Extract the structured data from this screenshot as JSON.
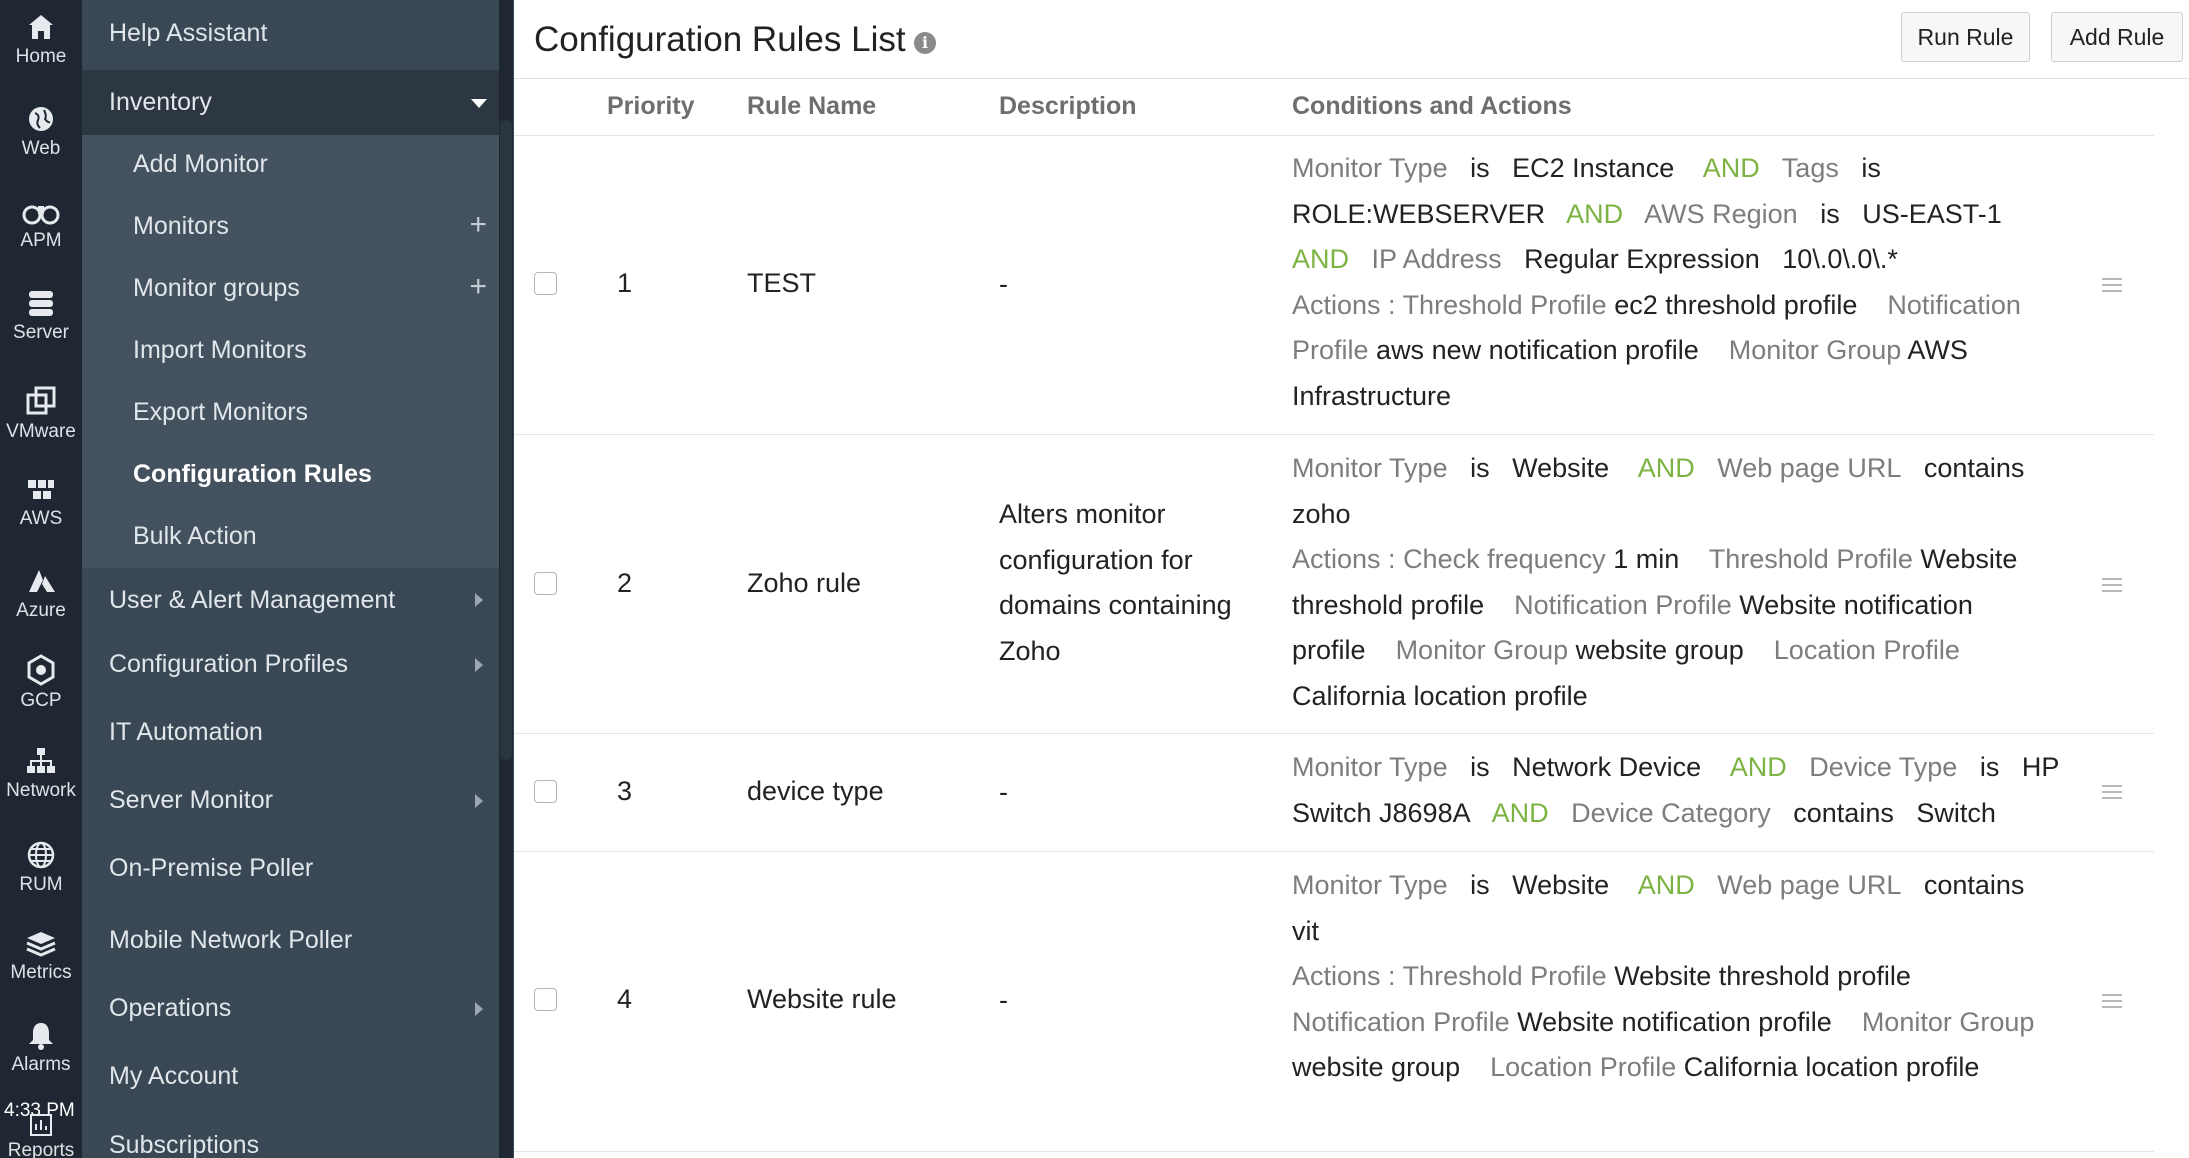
{
  "rail": {
    "items": [
      {
        "label": "Home",
        "icon": "home-icon"
      },
      {
        "label": "Web",
        "icon": "globe-icon"
      },
      {
        "label": "APM",
        "icon": "binoculars-icon"
      },
      {
        "label": "Server",
        "icon": "server-icon"
      },
      {
        "label": "VMware",
        "icon": "vmware-icon"
      },
      {
        "label": "AWS",
        "icon": "aws-cubes-icon"
      },
      {
        "label": "Azure",
        "icon": "azure-icon"
      },
      {
        "label": "GCP",
        "icon": "gcp-hexagon-icon"
      },
      {
        "label": "Network",
        "icon": "network-icon"
      },
      {
        "label": "RUM",
        "icon": "rum-globe-icon"
      },
      {
        "label": "Metrics",
        "icon": "layers-icon"
      },
      {
        "label": "Alarms",
        "icon": "bell-icon"
      }
    ],
    "time": "4:33 PM",
    "partial_label": "Reports"
  },
  "menu": {
    "top": [
      {
        "label": "Help Assistant"
      },
      {
        "label": "Inventory"
      }
    ],
    "sub": [
      {
        "label": "Add Monitor"
      },
      {
        "label": "Monitors"
      },
      {
        "label": "Monitor groups"
      },
      {
        "label": "Import Monitors"
      },
      {
        "label": "Export Monitors"
      },
      {
        "label": "Configuration Rules"
      },
      {
        "label": "Bulk Action"
      }
    ],
    "bottom": [
      {
        "label": "User & Alert Management"
      },
      {
        "label": "Configuration Profiles"
      },
      {
        "label": "IT Automation"
      },
      {
        "label": "Server Monitor"
      },
      {
        "label": "On-Premise Poller"
      },
      {
        "label": "Mobile Network Poller"
      },
      {
        "label": "Operations"
      },
      {
        "label": "My Account"
      },
      {
        "label": "Subscriptions"
      }
    ]
  },
  "header": {
    "title": "Configuration Rules List",
    "info_icon": "i",
    "run_rule": "Run Rule",
    "add_rule": "Add Rule"
  },
  "table": {
    "columns": [
      "Priority",
      "Rule Name",
      "Description",
      "Conditions and Actions"
    ],
    "rows": [
      {
        "priority": "1",
        "name": "TEST",
        "description": "-"
      },
      {
        "priority": "2",
        "name": "Zoho rule",
        "description": "Alters monitor configuration for domains containing Zoho"
      },
      {
        "priority": "3",
        "name": "device type",
        "description": "-"
      },
      {
        "priority": "4",
        "name": "Website rule",
        "description": "-"
      }
    ],
    "conditions": {
      "r1": {
        "k1": "Monitor Type",
        "o1": "is",
        "v1": "EC2 Instance",
        "and1": "AND",
        "k2": "Tags",
        "o2": "is",
        "v2": "ROLE:WEBSERVER",
        "and2": "AND",
        "k3": "AWS Region",
        "o3": "is",
        "v3": "US-EAST-1",
        "and3": "AND",
        "k4": "IP Address",
        "o4": "Regular Expression",
        "v4": "10\\.0\\.0\\.*",
        "actions": "Actions :",
        "a1k": "Threshold Profile",
        "a1v": "ec2 threshold profile",
        "a2k": "Notification Profile",
        "a2v": "aws new notification profile",
        "a3k": "Monitor Group",
        "a3v": "AWS Infrastructure"
      },
      "r2": {
        "k1": "Monitor Type",
        "o1": "is",
        "v1": "Website",
        "and1": "AND",
        "k2": "Web page URL",
        "o2": "contains",
        "v2": "zoho",
        "actions": "Actions :",
        "a1k": "Check frequency",
        "a1v": "1 min",
        "a2k": "Threshold Profile",
        "a2v": "Website threshold profile",
        "a3k": "Notification Profile",
        "a3v": "Website notification profile",
        "a4k": "Monitor Group",
        "a4v": "website group",
        "a5k": "Location Profile",
        "a5v": "California location profile"
      },
      "r3": {
        "k1": "Monitor Type",
        "o1": "is",
        "v1": "Network Device",
        "and1": "AND",
        "k2": "Device Type",
        "o2": "is",
        "v2": "HP Switch J8698A",
        "and2": "AND",
        "k3": "Device Category",
        "o3": "contains",
        "v3": "Switch"
      },
      "r4": {
        "k1": "Monitor Type",
        "o1": "is",
        "v1": "Website",
        "and1": "AND",
        "k2": "Web page URL",
        "o2": "contains",
        "v2": "vit",
        "actions": "Actions :",
        "a1k": "Threshold Profile",
        "a1v": "Website threshold profile",
        "a2k": "Notification Profile",
        "a2v": "Website notification profile",
        "a3k": "Monitor Group",
        "a3v": "website group",
        "a4k": "Location Profile",
        "a4v": "California location profile"
      }
    }
  },
  "colors": {
    "rail_bg": "#1f2832",
    "menu_bg": "#3a4755",
    "menu_active_bg": "#2c3742",
    "submenu_bg": "#44515f",
    "and_green": "#7cb342",
    "key_gray": "#7d7d7d"
  }
}
